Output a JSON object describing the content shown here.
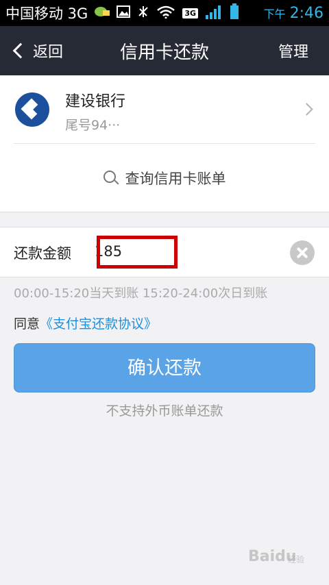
{
  "status_bar": {
    "carrier": "中国移动 3G",
    "network_badge": "3G",
    "ampm": "下午",
    "time": "2:46"
  },
  "header": {
    "back_label": "返回",
    "title": "信用卡还款",
    "manage_label": "管理"
  },
  "card": {
    "bank_name": "建设银行",
    "tail_number": "尾号94···",
    "query_label": "查询信用卡账单"
  },
  "amount": {
    "label": "还款金额",
    "value": "185"
  },
  "arrival_note": "00:00-15:20当天到账  15:20-24:00次日到账",
  "agreement": {
    "prefix": "同意",
    "link": "《支付宝还款协议》"
  },
  "confirm_button_label": "确认还款",
  "foreign_note": "不支持外币账单还款",
  "watermark": "Baidu",
  "watermark_sub": "经验",
  "colors": {
    "title_bar": "#262a35",
    "primary_button": "#5aa3e6",
    "link": "#1a90e0",
    "highlight": "#cc0000"
  }
}
